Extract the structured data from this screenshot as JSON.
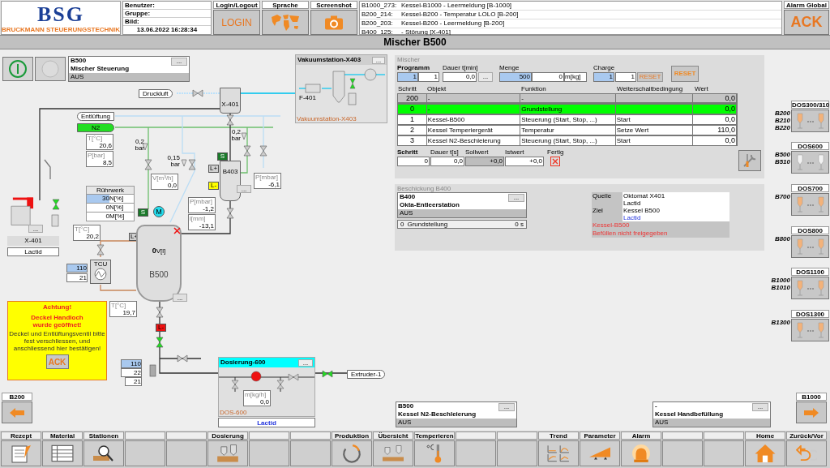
{
  "header": {
    "logo": {
      "mark": "BSG",
      "company": "BRUCKMANN STEUERUNGSTECHNIK"
    },
    "user_fields": [
      "Benutzer:",
      "Gruppe:",
      "Bild:"
    ],
    "datetime": "13.06.2022 16:28:34",
    "buttons": [
      {
        "caption": "Login/Logout",
        "kind": "text",
        "label": "LOGIN"
      },
      {
        "caption": "Sprache",
        "kind": "map"
      },
      {
        "caption": "Screenshot",
        "kind": "camera"
      }
    ],
    "alarms": [
      {
        "code": "B1000_273:",
        "text": "Kessel-B1000 - Leermeldung [B-1000]"
      },
      {
        "code": "B200_214:",
        "text": "Kessel-B200 - Temperatur LOLO [B-200]"
      },
      {
        "code": "B200_203:",
        "text": "Kessel-B200 - Leermeldung [B-200]"
      },
      {
        "code": "B400_125:",
        "text": "- Störung [X-401]"
      }
    ],
    "alarm_global": {
      "caption": "Alarm Global",
      "label": "ACK"
    }
  },
  "title": "Mischer B500",
  "diagram": {
    "power_buttons": [
      {
        "on": true
      },
      {
        "on": false
      }
    ],
    "controller": {
      "id": "B500",
      "name": "Mischer Steuerung",
      "status": "AUS",
      "more": "..."
    },
    "vacuum_station": {
      "title": "Vakuumstation-X403",
      "more": "...",
      "filter": "F-401",
      "caption": "Vakuumstation-X403"
    },
    "line_tags": [
      {
        "label": "Druckluft",
        "kind": "right",
        "active": false
      },
      {
        "label": "Entlüftung",
        "kind": "left",
        "active": false
      },
      {
        "label": "N2",
        "kind": "right",
        "active": true
      },
      {
        "label": "Extruder-1",
        "kind": "right",
        "active": false
      }
    ],
    "filter_label": "X-401",
    "buffer_vessel": "B403",
    "relief_labels": [
      "0,2 bar",
      "0,15 bar",
      "0,2 bar"
    ],
    "measurements": [
      {
        "label": "T[°C]",
        "value": "20,6"
      },
      {
        "label": "P[bar]",
        "value": "8,5"
      },
      {
        "label": "V[m³/h]",
        "value": "0,0"
      },
      {
        "label": "P[mbar]",
        "value": "-6,1"
      },
      {
        "label": "P[mbar]",
        "value": "-1,2"
      },
      {
        "label": "l[mm]",
        "value": "-13,1"
      },
      {
        "label": "T[°C]",
        "value": "20,2"
      },
      {
        "label": "T[°C]",
        "value": "19,7"
      },
      {
        "label": "m[kg/h]",
        "value": "0,0"
      }
    ],
    "indicators": [
      {
        "text": "S",
        "color": "#1a7a2a"
      },
      {
        "text": "L+",
        "color": "#d0d0d0"
      },
      {
        "text": "L-",
        "color": "#ffff00"
      },
      {
        "text": "S",
        "color": "#1a7a2a"
      },
      {
        "text": "L+",
        "color": "#d0d0d0"
      },
      {
        "text": "L-",
        "color": "#ee1111"
      }
    ],
    "agitator": {
      "title": "Rührwerk",
      "rows": [
        {
          "value": "30",
          "unit": "N[%]",
          "editable": true
        },
        {
          "value": "0",
          "unit": "N[%]",
          "editable": false
        },
        {
          "value": "0",
          "unit": "M[%]",
          "editable": false
        }
      ]
    },
    "motor": "M",
    "feed_container": {
      "id": "X-401",
      "material": "Lactid",
      "more": "..."
    },
    "tcu": {
      "label": "TCU",
      "setpoint": "110",
      "actual": "21"
    },
    "mixer_vessel": {
      "name": "B500",
      "volume": "0",
      "unit": "V[l]",
      "more": "..."
    },
    "outlet_values": [
      {
        "value": "110",
        "editable": true
      },
      {
        "value": "22",
        "editable": false
      },
      {
        "value": "21",
        "editable": false
      }
    ],
    "alert": {
      "title": "Achtung!",
      "headline": "Deckel Handloch wurde geöffnet!",
      "message": "Deckel und Entlüftungsventil bitte fest verschliessen, und anschliessend hier bestätigen!",
      "button": "ACK"
    },
    "dosing_unit": {
      "title": "Dosierung-600",
      "more": "...",
      "caption": "DOS-600",
      "material": "Lactid"
    },
    "nav": [
      {
        "label": "B200",
        "kind": "left"
      },
      {
        "label": "B1000",
        "kind": "right"
      }
    ]
  },
  "mixer": {
    "title": "Mischer",
    "program": {
      "label": "Programm",
      "values": [
        "1",
        "1"
      ]
    },
    "duration": {
      "label": "Dauer t[min]",
      "value": "0,0",
      "more": "..."
    },
    "amount": {
      "label": "Menge",
      "values": [
        "500",
        "0"
      ],
      "unit": "m[kg]"
    },
    "batch": {
      "label": "Charge",
      "values": [
        "1",
        "1"
      ],
      "reset": "RESET"
    },
    "reset": "RESET",
    "columns": [
      "Schritt",
      "Objekt",
      "Funktion",
      "Weiterschaltbedingung",
      "Wert"
    ],
    "rows": [
      {
        "kind": "end",
        "selected": false,
        "cells": [
          "200",
          "-",
          "-",
          "",
          "0,0"
        ]
      },
      {
        "kind": "step",
        "selected": true,
        "cells": [
          "0",
          "-",
          "Grundstellung",
          "",
          "0,0"
        ]
      },
      {
        "kind": "step",
        "selected": false,
        "cells": [
          "1",
          "Kessel-B500",
          "Steuerung (Start, Stop, ...)",
          "Start",
          "0,0"
        ]
      },
      {
        "kind": "step",
        "selected": false,
        "cells": [
          "2",
          "Kessel Temperiergerät",
          "Temperatur",
          "Setze Wert",
          "110,0"
        ]
      },
      {
        "kind": "step",
        "selected": false,
        "cells": [
          "3",
          "Kessel N2-Beschleierung",
          "Steuerung (Start, Stop, ...)",
          "Start",
          "0,0"
        ]
      }
    ],
    "step": {
      "labels": [
        "Schritt",
        "Dauer t[s]",
        "Sollwert",
        "Istwert",
        "Fertig"
      ],
      "values": [
        "0",
        "0,0",
        "+0,0",
        "+0,0"
      ],
      "done": false
    }
  },
  "loading": {
    "title": "Beschickung B400",
    "station": {
      "id": "B400",
      "name": "Okta-Entleerstation",
      "status": "AUS",
      "more": "..."
    },
    "step": {
      "number": "0",
      "name": "Grundstellung",
      "time": "0 s"
    },
    "source": {
      "label": "Quelle",
      "lines": [
        "Oktomat X401",
        "Lactid"
      ]
    },
    "target": {
      "label": "Ziel",
      "lines": [
        "Kessel B500",
        "Lactid"
      ]
    },
    "messages": [
      "Kessel-B500",
      "Befüllen nicht freigegeben"
    ]
  },
  "dosing_stations": [
    {
      "title": "DOS300/310",
      "vessels": [
        "B200",
        "B210",
        "B220"
      ],
      "enabled": true
    },
    {
      "title": "DOS600",
      "vessels": [
        "B500",
        "B510"
      ],
      "enabled": false
    },
    {
      "title": "DOS700",
      "vessels": [
        "B700"
      ],
      "enabled": true
    },
    {
      "title": "DOS800",
      "vessels": [
        "B800"
      ],
      "enabled": true
    },
    {
      "title": "DOS1100",
      "vessels": [
        "B1000",
        "B1010"
      ],
      "enabled": true
    },
    {
      "title": "DOS1300",
      "vessels": [
        "B1300"
      ],
      "enabled": true
    }
  ],
  "bottom_faceplates": [
    {
      "id": "B500",
      "name": "Kessel N2-Beschleierung",
      "status": "AUS",
      "more": "..."
    },
    {
      "id": "-",
      "name": "Kessel Handbefüllung",
      "status": "AUS",
      "more": "..."
    }
  ],
  "toolbar": [
    {
      "caption": "Rezept",
      "kind": "recipe"
    },
    {
      "caption": "Material",
      "kind": "list"
    },
    {
      "caption": "Stationen",
      "kind": "magnifier"
    },
    {
      "kind": "empty"
    },
    {
      "kind": "empty"
    },
    {
      "caption": "Dosierung",
      "kind": "dosing"
    },
    {
      "kind": "empty"
    },
    {
      "kind": "empty"
    },
    {
      "caption": "Produktion",
      "kind": "cycle"
    },
    {
      "caption": "Übersicht",
      "kind": "overview"
    },
    {
      "caption": "Temperieren",
      "kind": "thermometer"
    },
    {
      "kind": "empty"
    },
    {
      "kind": "empty"
    },
    {
      "caption": "Trend",
      "kind": "trend"
    },
    {
      "caption": "Parameter",
      "kind": "ramp"
    },
    {
      "caption": "Alarm",
      "kind": "beacon"
    },
    {
      "kind": "empty"
    },
    {
      "kind": "empty"
    },
    {
      "caption": "Home",
      "kind": "home"
    },
    {
      "caption": "Zurück/Vor",
      "kind": "undo"
    }
  ]
}
